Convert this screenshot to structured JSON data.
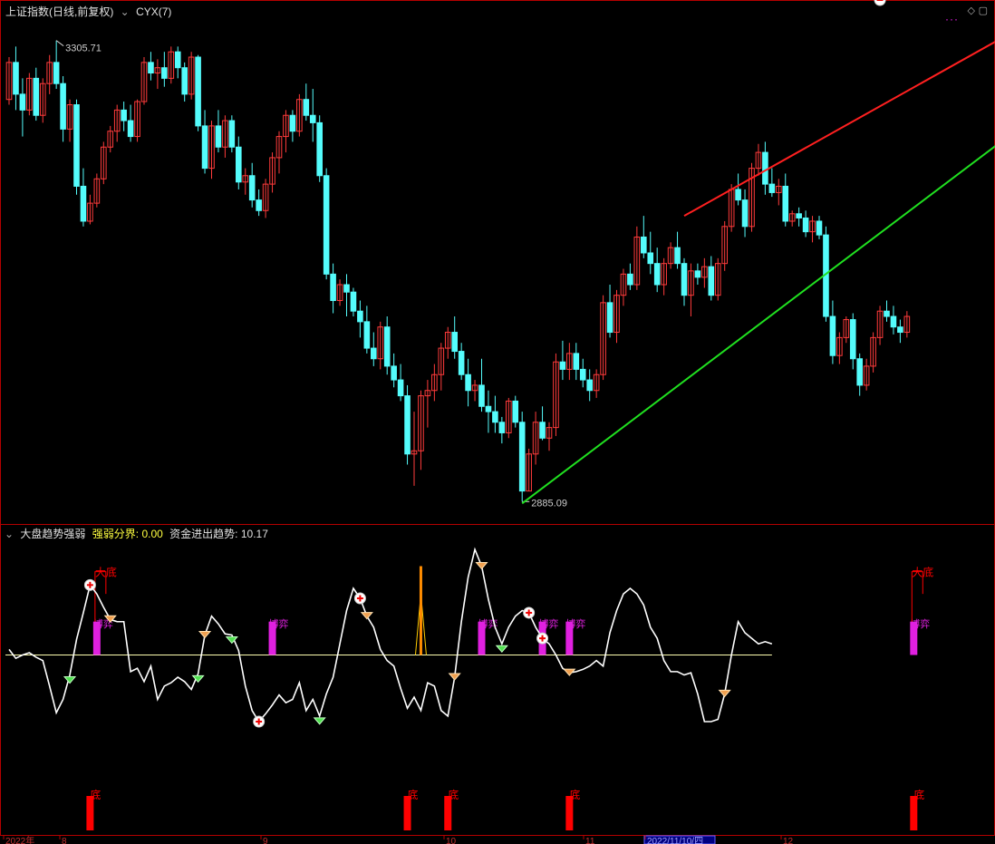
{
  "top_panel": {
    "title": "上证指数(日线,前复权)",
    "indicator": "CYX(7)",
    "high_label": "3305.71",
    "low_label": "2885.09"
  },
  "bottom_panel": {
    "title": "大盘趋势强弱",
    "param1_label": "强弱分界:",
    "param1_value": "0.00",
    "param2_label": "资金进出趋势:",
    "param2_value": "10.17",
    "label_big_bottom": "大底",
    "label_game": "博弈",
    "label_bottom": "底"
  },
  "x_axis": {
    "labels": [
      "2022年",
      "8",
      "9",
      "10",
      "11",
      "2022/11/10/四",
      "12"
    ]
  },
  "colors": {
    "up": "#ff3b3b",
    "down": "#54fcfc",
    "frame": "#b40000",
    "resistance": "#ff2020",
    "support": "#20e020",
    "line": "#ffffff",
    "magenta": "#e020e0",
    "orange": "#ff8c00",
    "red_bar": "#ff0000"
  },
  "chart_data": [
    {
      "type": "candlestick",
      "title": "上证指数(日线,前复权)",
      "candles": [
        [
          3250,
          3290,
          3245,
          3285
        ],
        [
          3285,
          3300,
          3240,
          3255
        ],
        [
          3255,
          3270,
          3215,
          3240
        ],
        [
          3240,
          3275,
          3235,
          3270
        ],
        [
          3270,
          3280,
          3230,
          3235
        ],
        [
          3235,
          3270,
          3228,
          3265
        ],
        [
          3265,
          3292,
          3255,
          3285
        ],
        [
          3285,
          3305.71,
          3260,
          3265
        ],
        [
          3265,
          3272,
          3210,
          3222
        ],
        [
          3222,
          3250,
          3210,
          3245
        ],
        [
          3245,
          3250,
          3160,
          3168
        ],
        [
          3168,
          3185,
          3130,
          3135
        ],
        [
          3135,
          3160,
          3132,
          3152
        ],
        [
          3152,
          3180,
          3148,
          3175
        ],
        [
          3175,
          3210,
          3170,
          3205
        ],
        [
          3205,
          3225,
          3200,
          3220
        ],
        [
          3220,
          3245,
          3210,
          3240
        ],
        [
          3240,
          3248,
          3220,
          3230
        ],
        [
          3230,
          3245,
          3210,
          3215
        ],
        [
          3215,
          3250,
          3210,
          3248
        ],
        [
          3248,
          3290,
          3245,
          3285
        ],
        [
          3285,
          3295,
          3268,
          3275
        ],
        [
          3275,
          3288,
          3260,
          3280
        ],
        [
          3280,
          3295,
          3262,
          3270
        ],
        [
          3270,
          3300,
          3265,
          3295
        ],
        [
          3295,
          3300,
          3270,
          3280
        ],
        [
          3280,
          3285,
          3248,
          3255
        ],
        [
          3255,
          3295,
          3250,
          3290
        ],
        [
          3290,
          3292,
          3220,
          3225
        ],
        [
          3225,
          3240,
          3180,
          3185
        ],
        [
          3185,
          3230,
          3175,
          3225
        ],
        [
          3225,
          3240,
          3200,
          3205
        ],
        [
          3205,
          3235,
          3195,
          3230
        ],
        [
          3230,
          3235,
          3200,
          3205
        ],
        [
          3205,
          3215,
          3165,
          3172
        ],
        [
          3172,
          3185,
          3160,
          3178
        ],
        [
          3178,
          3190,
          3148,
          3155
        ],
        [
          3155,
          3165,
          3140,
          3145
        ],
        [
          3145,
          3175,
          3138,
          3170
        ],
        [
          3170,
          3200,
          3162,
          3195
        ],
        [
          3195,
          3220,
          3180,
          3215
        ],
        [
          3215,
          3240,
          3200,
          3235
        ],
        [
          3235,
          3240,
          3210,
          3220
        ],
        [
          3220,
          3255,
          3215,
          3250
        ],
        [
          3250,
          3265,
          3230,
          3235
        ],
        [
          3235,
          3260,
          3210,
          3228
        ],
        [
          3228,
          3235,
          3172,
          3178
        ],
        [
          3178,
          3185,
          3080,
          3085
        ],
        [
          3085,
          3095,
          3048,
          3060
        ],
        [
          3060,
          3080,
          3055,
          3075
        ],
        [
          3075,
          3085,
          3045,
          3068
        ],
        [
          3068,
          3072,
          3045,
          3050
        ],
        [
          3050,
          3060,
          3025,
          3040
        ],
        [
          3040,
          3055,
          3010,
          3015
        ],
        [
          3015,
          3030,
          2998,
          3005
        ],
        [
          3005,
          3040,
          2995,
          3035
        ],
        [
          3035,
          3045,
          2990,
          2998
        ],
        [
          2998,
          3010,
          2978,
          2985
        ],
        [
          2985,
          3000,
          2965,
          2970
        ],
        [
          2970,
          2980,
          2905,
          2915
        ],
        [
          2915,
          2955,
          2885,
          2918
        ],
        [
          2918,
          2975,
          2900,
          2970
        ],
        [
          2970,
          2985,
          2940,
          2975
        ],
        [
          2975,
          3000,
          2965,
          2990
        ],
        [
          2990,
          3020,
          2975,
          3015
        ],
        [
          3015,
          3035,
          3005,
          3030
        ],
        [
          3030,
          3045,
          3005,
          3012
        ],
        [
          3012,
          3020,
          2985,
          2990
        ],
        [
          2990,
          3005,
          2960,
          2975
        ],
        [
          2975,
          2985,
          2965,
          2980
        ],
        [
          2980,
          3005,
          2955,
          2960
        ],
        [
          2960,
          2975,
          2935,
          2955
        ],
        [
          2955,
          2970,
          2935,
          2945
        ],
        [
          2945,
          2950,
          2925,
          2935
        ],
        [
          2935,
          2968,
          2930,
          2965
        ],
        [
          2965,
          2970,
          2940,
          2945
        ],
        [
          2945,
          2955,
          2870,
          2880
        ],
        [
          2880,
          2920,
          2880,
          2915
        ],
        [
          2915,
          2955,
          2905,
          2945
        ],
        [
          2945,
          2960,
          2928,
          2930
        ],
        [
          2930,
          2945,
          2918,
          2940
        ],
        [
          2940,
          3010,
          2932,
          3002
        ],
        [
          3002,
          3022,
          2985,
          2995
        ],
        [
          2995,
          3020,
          2985,
          3010
        ],
        [
          3010,
          3020,
          2985,
          2995
        ],
        [
          2995,
          3005,
          2978,
          2985
        ],
        [
          2985,
          2995,
          2965,
          2975
        ],
        [
          2975,
          2995,
          2968,
          2990
        ],
        [
          2990,
          3065,
          2985,
          3058
        ],
        [
          3058,
          3075,
          3025,
          3030
        ],
        [
          3030,
          3070,
          3020,
          3065
        ],
        [
          3065,
          3090,
          3055,
          3085
        ],
        [
          3085,
          3095,
          3070,
          3075
        ],
        [
          3075,
          3130,
          3070,
          3120
        ],
        [
          3120,
          3140,
          3100,
          3105
        ],
        [
          3105,
          3125,
          3085,
          3095
        ],
        [
          3095,
          3110,
          3068,
          3075
        ],
        [
          3075,
          3100,
          3065,
          3095
        ],
        [
          3095,
          3115,
          3090,
          3110
        ],
        [
          3110,
          3125,
          3090,
          3095
        ],
        [
          3095,
          3100,
          3055,
          3065
        ],
        [
          3065,
          3095,
          3045,
          3088
        ],
        [
          3088,
          3095,
          3075,
          3082
        ],
        [
          3082,
          3100,
          3072,
          3092
        ],
        [
          3092,
          3102,
          3060,
          3065
        ],
        [
          3065,
          3100,
          3060,
          3095
        ],
        [
          3095,
          3135,
          3088,
          3130
        ],
        [
          3130,
          3170,
          3125,
          3165
        ],
        [
          3165,
          3180,
          3150,
          3155
        ],
        [
          3155,
          3165,
          3120,
          3130
        ],
        [
          3130,
          3190,
          3125,
          3185
        ],
        [
          3185,
          3208,
          3178,
          3200
        ],
        [
          3200,
          3210,
          3160,
          3170
        ],
        [
          3170,
          3185,
          3158,
          3162
        ],
        [
          3162,
          3175,
          3150,
          3168
        ],
        [
          3168,
          3180,
          3130,
          3135
        ],
        [
          3135,
          3145,
          3130,
          3142
        ],
        [
          3142,
          3148,
          3130,
          3138
        ],
        [
          3138,
          3145,
          3120,
          3125
        ],
        [
          3125,
          3140,
          3115,
          3135
        ],
        [
          3135,
          3140,
          3118,
          3122
        ],
        [
          3122,
          3130,
          3040,
          3045
        ],
        [
          3045,
          3060,
          3000,
          3008
        ],
        [
          3008,
          3030,
          3000,
          3025
        ],
        [
          3025,
          3045,
          3020,
          3042
        ],
        [
          3042,
          3048,
          2995,
          3005
        ],
        [
          3005,
          3010,
          2970,
          2980
        ],
        [
          2980,
          3005,
          2975,
          2998
        ],
        [
          2998,
          3030,
          2992,
          3025
        ],
        [
          3025,
          3055,
          3018,
          3050
        ],
        [
          3050,
          3060,
          3040,
          3045
        ],
        [
          3045,
          3055,
          3028,
          3035
        ],
        [
          3035,
          3042,
          3020,
          3030
        ],
        [
          3030,
          3050,
          3025,
          3045
        ]
      ],
      "high_marker": "3305.71",
      "low_marker": "2885.09"
    },
    {
      "type": "line",
      "title": "大盘趋势强弱",
      "threshold": 0.0,
      "last_value": 10.17,
      "series": [
        {
          "values": [
            5,
            -3,
            0,
            2,
            -2,
            -5,
            -28,
            -52,
            -40,
            -18,
            14,
            38,
            63,
            55,
            43,
            32,
            30,
            30,
            -15,
            -12,
            -24,
            -10,
            -40,
            -28,
            -25,
            -20,
            -24,
            -31,
            -17,
            18,
            35,
            28,
            19,
            18,
            4,
            -28,
            -50,
            -60,
            -53,
            -45,
            -36,
            -43,
            -40,
            -25,
            -50,
            -40,
            -55,
            -35,
            -20,
            10,
            40,
            60,
            51,
            35,
            25,
            5,
            -5,
            -10,
            -30,
            -48,
            -38,
            -50,
            -25,
            -28,
            -50,
            -55,
            -20,
            30,
            70,
            95,
            80,
            50,
            25,
            10,
            25,
            35,
            40,
            38,
            25,
            15,
            10,
            0,
            -12,
            -16,
            -15,
            -13,
            -10,
            -5,
            -10,
            20,
            40,
            55,
            60,
            55,
            45,
            25,
            15,
            -5,
            -15,
            -15,
            -18,
            -16,
            -35,
            -60,
            -60,
            -58,
            -35,
            0,
            30,
            20,
            15,
            10,
            12,
            10
          ]
        }
      ],
      "tall_bars_idx": [
        13,
        39,
        70,
        79,
        83,
        134
      ],
      "tall_bar_labels_idx": [
        13,
        134
      ],
      "spike_idx": 61,
      "orange_markers_idx": [
        15,
        29,
        53,
        66,
        70,
        83,
        106,
        131,
        138,
        140
      ],
      "green_markers_idx": [
        9,
        28,
        33,
        46,
        73,
        124
      ],
      "plus_markers_idx": [
        12,
        37,
        52,
        77,
        79,
        129
      ],
      "bottom_bars_idx": [
        12,
        59,
        65,
        83,
        134
      ]
    }
  ]
}
